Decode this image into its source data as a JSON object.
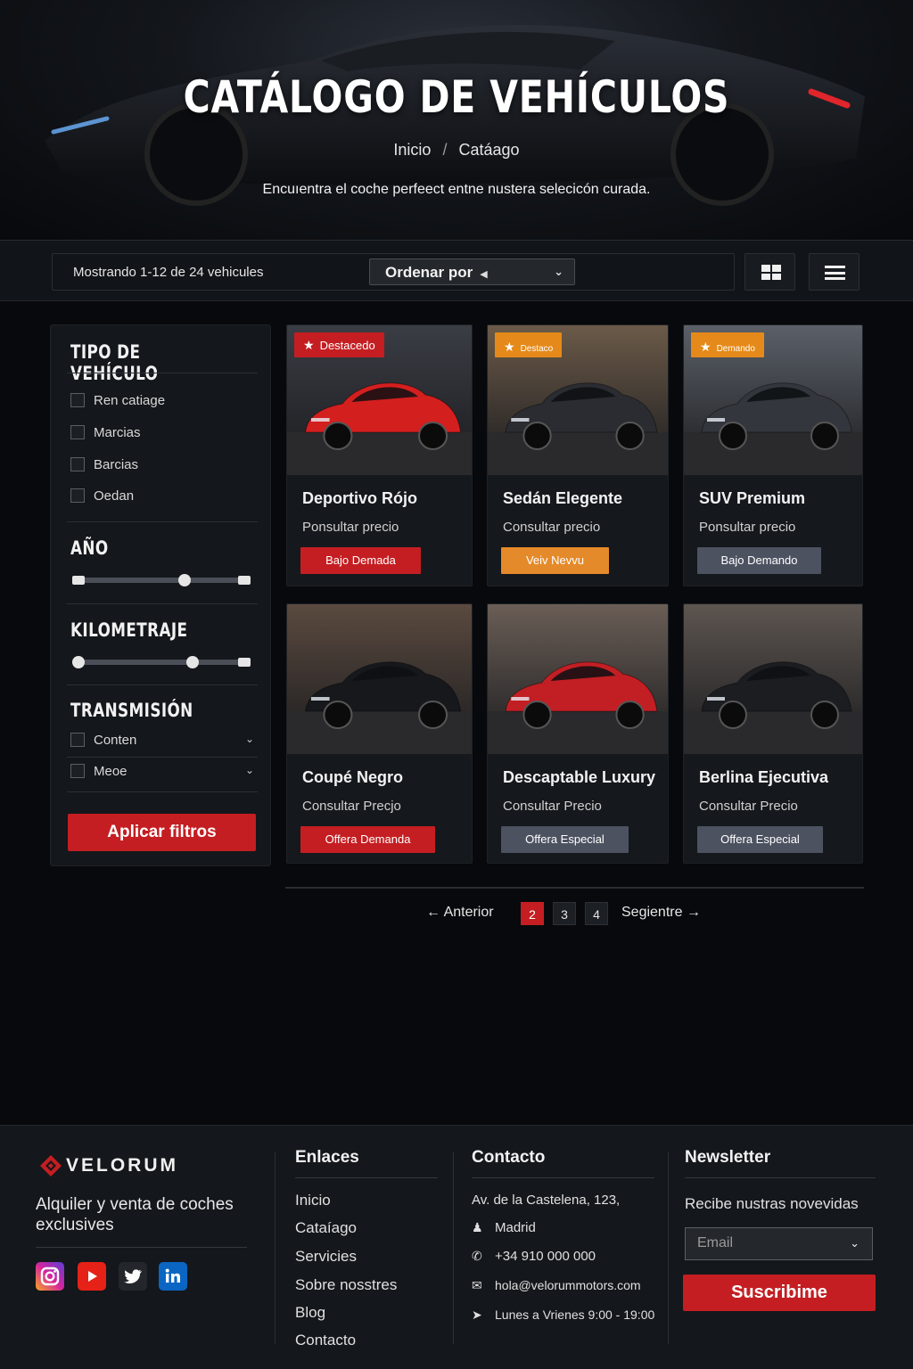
{
  "hero": {
    "title": "CATÁLOGO DE VEHÍCULOS",
    "breadcrumb": [
      "Inicio",
      "Catáago"
    ],
    "breadcrumb_sep": "/",
    "subtitle": "Encuıentra el coche perfeect entne nustera selecicón curada."
  },
  "toolbar": {
    "showing": "Mostrando 1-12 de 24 vehicules",
    "sort_label": "Ordenar por",
    "sort_icon": "caret-left",
    "views": [
      "grid-view-icon",
      "list-view-icon"
    ]
  },
  "filters": {
    "type_heading": "TIPO DE VEHÍCULO",
    "types": [
      "Ren catiage",
      "Marcias",
      "Barcias",
      "Oedan"
    ],
    "year_heading": "AÑO",
    "year_range": {
      "low": 0.0,
      "mid": 0.64,
      "high": 1.0
    },
    "km_heading": "KILOMETRAJE",
    "km_range": {
      "low": 0.0,
      "mid": 0.69,
      "high": 1.0
    },
    "transmission_heading": "TRANSMISIÓN",
    "transmissions": [
      "Conten",
      "Meoe"
    ],
    "apply_label": "Aplicar filtros"
  },
  "cars": [
    {
      "badge": "Destacedo",
      "badge_color": "#c41e22",
      "title": "Deportivo Rójo",
      "price": "Ponsultar precio",
      "tag": "Bajo Demada",
      "tag_color": "#c41e22",
      "paint": "#d41f1f"
    },
    {
      "badge": "Destaco",
      "badge_color": "#e58a1a",
      "title": "Sedán Elegente",
      "price": "Consultar precio",
      "tag": "Veiv Nevvu",
      "tag_color": "#e58a2a",
      "paint": "#2a2c31"
    },
    {
      "badge": "Demando",
      "badge_color": "#e58a1a",
      "title": "SUV Premium",
      "price": "Ponsultar precio",
      "tag": "Bajo Demando",
      "tag_color": "#4c5260",
      "paint": "#33363c"
    },
    {
      "badge": "",
      "badge_color": "",
      "title": "Coupé Negro",
      "price": "Consultar Precjo",
      "tag": "Offera Demanda",
      "tag_color": "#c41e22",
      "paint": "#16181c"
    },
    {
      "badge": "",
      "badge_color": "",
      "title": "Descaptable Luxury",
      "price": "Consultar Precio",
      "tag": "Offera Especial",
      "tag_color": "#4c5260",
      "paint": "#c21f24"
    },
    {
      "badge": "",
      "badge_color": "",
      "title": "Berlina Ejecutiva",
      "price": "Consultar Precio",
      "tag": "Offera Especial",
      "tag_color": "#4c5260",
      "paint": "#1b1d21"
    }
  ],
  "pagination": {
    "prev": "← Anterior",
    "pages": [
      "2",
      "3",
      "4"
    ],
    "active": "2",
    "next": "Segientre →"
  },
  "footer": {
    "brand": "VELORUM",
    "tagline": "Alquiler y venta de coches exclusives",
    "social": [
      "instagram-icon",
      "youtube-icon",
      "twitter-icon",
      "linkedin-icon"
    ],
    "links_heading": "Enlaces",
    "links": [
      "Inicio",
      "Cataíago",
      "Servicies",
      "Sobre nosstres",
      "Blog",
      "Contacto"
    ],
    "contact_heading": "Contacto",
    "contact": [
      {
        "icon": "",
        "text": "Av. de la Castelena, 123,"
      },
      {
        "icon": "person-icon",
        "text": "Madrid"
      },
      {
        "icon": "phone-icon",
        "text": "+34 910 000 000"
      },
      {
        "icon": "mail-icon",
        "text": "hola@velorummotors.com"
      },
      {
        "icon": "megaphone-icon",
        "text": "Lunes a Vrienes 9:00 - 19:00"
      }
    ],
    "newsletter_heading": "Newsletter",
    "newsletter_text": "Recibe nustras novevidas",
    "email_placeholder": "Email",
    "subscribe_label": "Suscribime"
  },
  "colors": {
    "accent": "#c41e22",
    "badge_orange": "#e58a1a",
    "background": "#07090c",
    "panel": "#14171b"
  }
}
